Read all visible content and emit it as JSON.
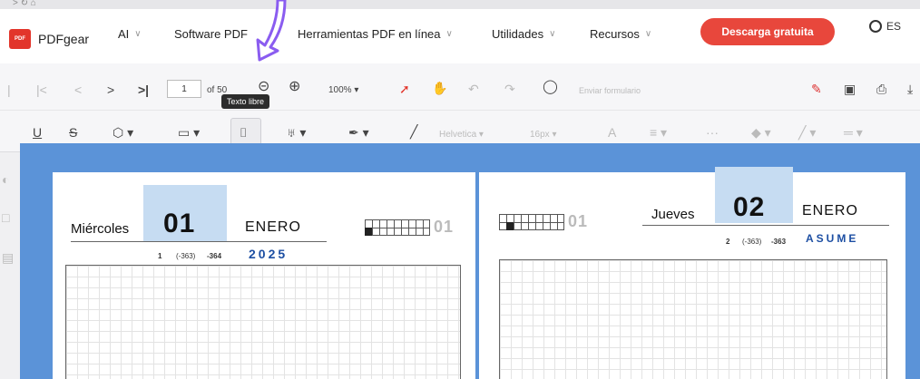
{
  "browser": {
    "tab_hint": "> ↻ ⌂"
  },
  "nav": {
    "brand": "PDFgear",
    "logo_text": "PDF",
    "items": [
      {
        "label": "AI",
        "has_chevron": true
      },
      {
        "label": "Software PDF",
        "has_chevron": false
      },
      {
        "label": "Herramientas PDF en línea",
        "has_chevron": true
      },
      {
        "label": "Utilidades",
        "has_chevron": true
      },
      {
        "label": "Recursos",
        "has_chevron": true
      }
    ],
    "cta": "Descarga gratuita",
    "lang": "ES",
    "accent_color": "#e8473c"
  },
  "toolbar": {
    "page_current": "1",
    "page_total": "of 50",
    "zoom": "100%",
    "form_placeholder": "Enviar formulario",
    "tooltip": "Texto libre",
    "font_name": "Helvetica",
    "font_size": "16px",
    "text_color_glyph": "A",
    "more_glyph": "···"
  },
  "calendar": {
    "left": {
      "weekday": "Miércoles",
      "day": "01",
      "month": "ENERO",
      "day_of_year": "1",
      "remaining_paren": "(-363)",
      "remaining": "-364",
      "accent_text": "2025",
      "mini_num": "01"
    },
    "right": {
      "weekday": "Jueves",
      "day": "02",
      "month": "ENERO",
      "day_of_year": "2",
      "remaining_paren": "(-363)",
      "remaining": "-363",
      "accent_text": "ASUME",
      "mini_num": "01"
    },
    "band_color": "#c6dcf2",
    "frame_color": "#5b93d8"
  }
}
